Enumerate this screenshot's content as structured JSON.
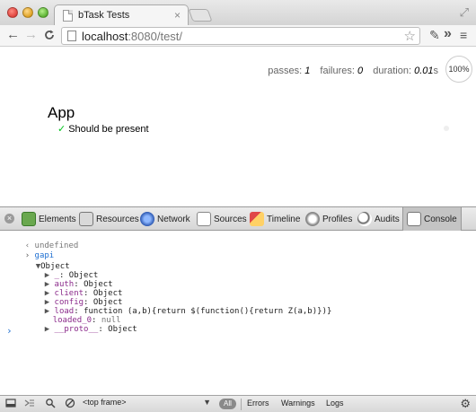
{
  "browser": {
    "tab_title": "bTask Tests",
    "tab_close": "×",
    "url_host": "localhost",
    "url_path": ":8080/test/"
  },
  "toolbar_icons": {
    "back": "←",
    "forward": "→",
    "reload": "C",
    "star": "☆",
    "wrench": "✎",
    "chevron": "»",
    "menu": "≡",
    "fullscreen": "⤢"
  },
  "stats": {
    "passes_label": "passes:",
    "passes": "1",
    "failures_label": "failures:",
    "failures": "0",
    "duration_label": "duration:",
    "duration": "0.01",
    "duration_unit": "s",
    "progress": "100%"
  },
  "suite": {
    "title": "App",
    "check": "✓",
    "test": "Should be present"
  },
  "devtools": {
    "close": "×",
    "tabs": [
      {
        "label": "Elements"
      },
      {
        "label": "Resources"
      },
      {
        "label": "Network"
      },
      {
        "label": "Sources"
      },
      {
        "label": "Timeline"
      },
      {
        "label": "Profiles"
      },
      {
        "label": "Audits"
      },
      {
        "label": "Console"
      }
    ],
    "active_tab": "Console"
  },
  "console": {
    "l1_arrow": "‹",
    "l1_text": "undefined",
    "l2_arrow": "›",
    "l2_text": "gapi",
    "l3_arrow": "▼",
    "l3_text": "Object",
    "props": [
      {
        "arrow": "▶",
        "key": "_",
        "sep": ": ",
        "val": "Object"
      },
      {
        "arrow": "▶",
        "key": "auth",
        "sep": ": ",
        "val": "Object"
      },
      {
        "arrow": "▶",
        "key": "client",
        "sep": ": ",
        "val": "Object"
      },
      {
        "arrow": "▶",
        "key": "config",
        "sep": ": ",
        "val": "Object"
      },
      {
        "arrow": "▶",
        "key": "load",
        "sep": ": ",
        "val": "function (a,b){return $(function(){return Z(a,b)})}"
      },
      {
        "arrow": "",
        "key": "loaded_0",
        "sep": ": ",
        "val": "null"
      },
      {
        "arrow": "▶",
        "key": "__proto__",
        "sep": ": ",
        "val": "Object"
      }
    ],
    "prompt": "›"
  },
  "statusbar": {
    "frame": "<top frame>",
    "caret": "▼",
    "all": "All",
    "errors": "Errors",
    "warnings": "Warnings",
    "logs": "Logs",
    "gear": "⚙"
  }
}
